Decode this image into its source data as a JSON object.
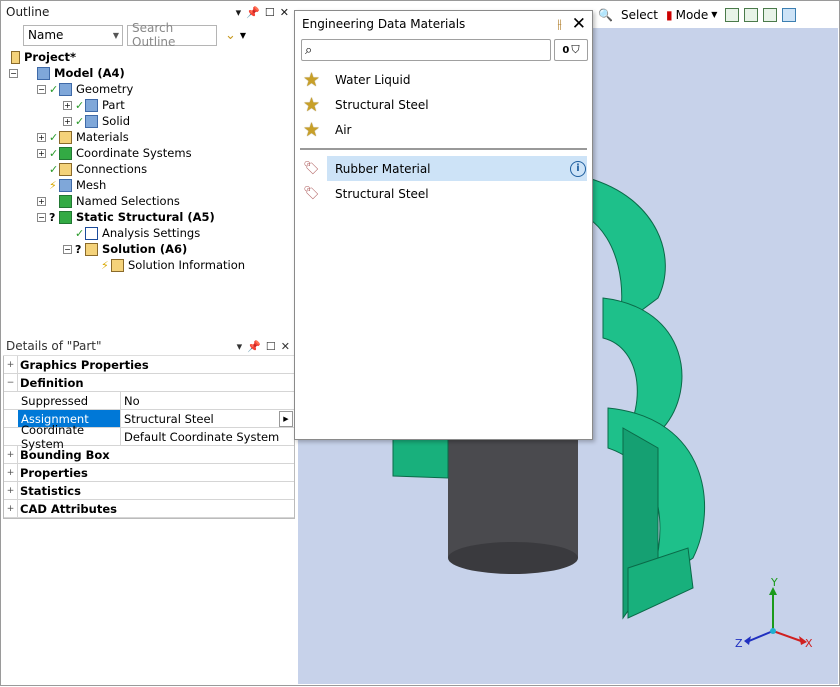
{
  "outline": {
    "title": "Outline",
    "filter_value": "Name",
    "search_placeholder": "Search Outline",
    "tree": [
      {
        "label": "Project*",
        "bold": true
      },
      {
        "label": "Model (A4)",
        "bold": true
      },
      {
        "label": "Geometry"
      },
      {
        "label": "Part"
      },
      {
        "label": "Solid"
      },
      {
        "label": "Materials"
      },
      {
        "label": "Coordinate Systems"
      },
      {
        "label": "Connections"
      },
      {
        "label": "Mesh"
      },
      {
        "label": "Named Selections"
      },
      {
        "label": "Static Structural (A5)",
        "bold": true
      },
      {
        "label": "Analysis Settings"
      },
      {
        "label": "Solution (A6)",
        "bold": true
      },
      {
        "label": "Solution Information"
      }
    ]
  },
  "details": {
    "title": "Details of \"Part\"",
    "groups": {
      "graphics": "Graphics Properties",
      "definition": "Definition",
      "bounding": "Bounding Box",
      "properties": "Properties",
      "statistics": "Statistics",
      "cad": "CAD Attributes"
    },
    "rows": {
      "suppressed_k": "Suppressed",
      "suppressed_v": "No",
      "assignment_k": "Assignment",
      "assignment_v": "Structural Steel",
      "coord_k": "Coordinate System",
      "coord_v": "Default Coordinate System"
    }
  },
  "toolbar": {
    "select_label": "Select",
    "mode_label": "Mode"
  },
  "popup": {
    "title": "Engineering Data Materials",
    "filter_count": "0",
    "favorites": [
      "Water Liquid",
      "Structural Steel",
      "Air"
    ],
    "materials": [
      "Rubber Material",
      "Structural Steel"
    ]
  },
  "axes": {
    "x": "X",
    "y": "Y",
    "z": "Z"
  },
  "colors": {
    "model": "#1ec08a",
    "cylinder": "#4a4a4e",
    "viewport_bg": "#c7d2ea",
    "selection": "#cde3f7"
  }
}
